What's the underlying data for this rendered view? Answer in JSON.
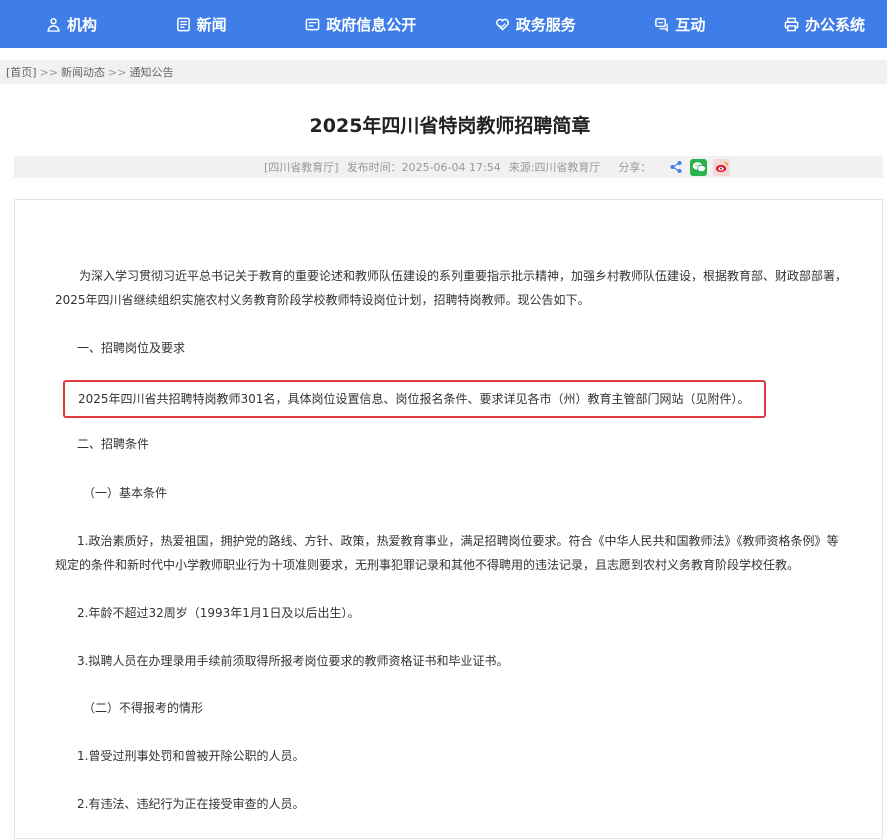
{
  "nav": {
    "items": [
      {
        "label": "机构",
        "icon": "people-icon"
      },
      {
        "label": "新闻",
        "icon": "newspaper-icon"
      },
      {
        "label": "政府信息公开",
        "icon": "document-icon"
      },
      {
        "label": "政务服务",
        "icon": "heart-hand-icon"
      },
      {
        "label": "互动",
        "icon": "chat-icon"
      },
      {
        "label": "办公系统",
        "icon": "printer-icon"
      }
    ],
    "background": "#3f7ee8"
  },
  "breadcrumb": {
    "home": "[首页]",
    "sep": ">>",
    "level1": "新闻动态",
    "level2": "通知公告"
  },
  "article": {
    "title": "2025年四川省特岗教师招聘简章",
    "meta": {
      "source_tag": "[四川省教育厅]",
      "publish_label": "发布时间：",
      "publish_time": "2025-06-04 17:54",
      "source_label": "来源:",
      "source": "四川省教育厅",
      "share_label": "分享："
    },
    "paragraphs": {
      "intro1": "为深入学习贯彻习近平总书记关于教育的重要论述和教师队伍建设的系列重要指示批示精神，加强乡村教师队伍建设，根据教育部、财政部部署，",
      "intro2": "2025年四川省继续组织实施农村义务教育阶段学校教师特设岗位计划，招聘特岗教师。现公告如下。",
      "section1": "一、招聘岗位及要求",
      "highlight": "2025年四川省共招聘特岗教师301名，具体岗位设置信息、岗位报名条件、要求详见各市（州）教育主管部门网站（见附件）。",
      "section2": "二、招聘条件",
      "sub1": "（一）基本条件",
      "cond1a": "1.政治素质好，热爱祖国，拥护党的路线、方针、政策，热爱教育事业，满足招聘岗位要求。符合《中华人民共和国教师法》《教师资格条例》等",
      "cond1b": "规定的条件和新时代中小学教师职业行为十项准则要求，无刑事犯罪记录和其他不得聘用的违法记录，且志愿到农村义务教育阶段学校任教。",
      "cond2": "2.年龄不超过32周岁（1993年1月1日及以后出生）。",
      "cond3": "3.拟聘人员在办理录用手续前须取得所报考岗位要求的教师资格证书和毕业证书。",
      "sub2": "（二）不得报考的情形",
      "excl1": "1.曾受过刑事处罚和曾被开除公职的人员。",
      "excl2": "2.有违法、违纪行为正在接受审查的人员。"
    },
    "highlight_color": "#e0393e"
  }
}
